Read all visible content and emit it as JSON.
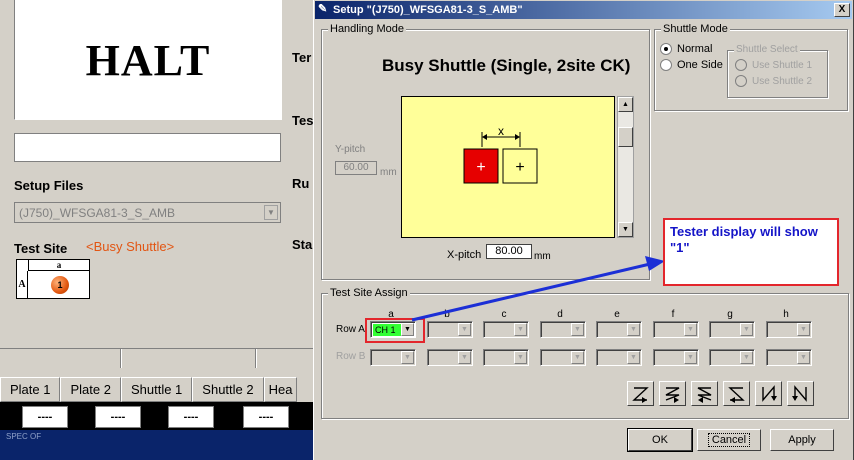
{
  "background_app": {
    "halt_text": "HALT",
    "setup_files_label": "Setup Files",
    "setup_file_value": "(J750)_WFSGA81-3_S_AMB",
    "test_site_label": "Test Site",
    "busy_shuttle_tag": "<Busy Shuttle>",
    "site_col": "a",
    "site_row": "A",
    "site_value": "1",
    "side_labels": [
      "Ter",
      "Tes",
      "Ru",
      "Sta"
    ],
    "tabs": [
      "Plate 1",
      "Plate 2",
      "Shuttle 1",
      "Shuttle 2",
      "Hea"
    ],
    "dash_values": [
      "----",
      "----",
      "----",
      "----"
    ],
    "bottom_text": "SPEC OF"
  },
  "dialog": {
    "title": "Setup \"(J750)_WFSGA81-3_S_AMB\"",
    "close_label": "X",
    "handling_mode": {
      "group_title": "Handling Mode",
      "mode_title": "Busy Shuttle (Single, 2site CK)",
      "y_pitch_label": "Y-pitch",
      "y_pitch_value": "60.00",
      "x_pitch_label": "X-pitch",
      "x_pitch_value": "80.00",
      "unit": "mm",
      "x_marker": "x",
      "plus": "+"
    },
    "shuttle_mode": {
      "group_title": "Shuttle Mode",
      "normal_label": "Normal",
      "one_side_label": "One Side",
      "selected": "Normal",
      "select_group_title": "Shuttle Select",
      "use_shuttle_1": "Use Shuttle 1",
      "use_shuttle_2": "Use Shuttle 2"
    },
    "test_site_assign": {
      "group_title": "Test Site Assign",
      "columns": [
        "a",
        "b",
        "c",
        "d",
        "e",
        "f",
        "g",
        "h"
      ],
      "row_a_label": "Row A",
      "row_b_label": "Row B",
      "row_a_a_value": "CH 1"
    },
    "buttons": {
      "ok": "OK",
      "cancel": "Cancel",
      "apply": "Apply"
    }
  },
  "annotation": {
    "text": "Tester display will show \"1\"",
    "color": "#1414c8",
    "border_color": "#e3262c"
  },
  "colors": {
    "title_bar_start": "#0a246a",
    "canvas_bg": "#ffff99",
    "site_red": "#e60000",
    "ch_green": "#33ff33",
    "busy_orange": "#e25513"
  }
}
